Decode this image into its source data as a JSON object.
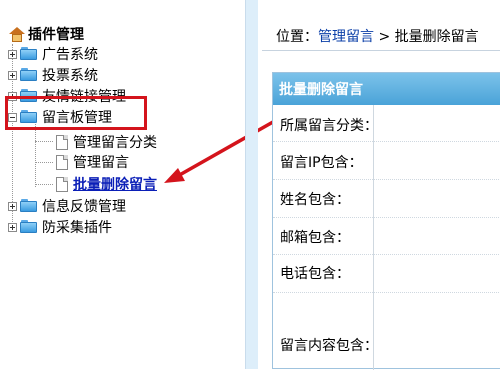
{
  "tree": {
    "root_label": "插件管理",
    "items": [
      {
        "label": "广告系统"
      },
      {
        "label": "投票系统"
      },
      {
        "label": "友情链接管理"
      },
      {
        "label": "留言板管理"
      },
      {
        "label": "管理留言分类"
      },
      {
        "label": "管理留言"
      },
      {
        "label": "批量删除留言"
      },
      {
        "label": "信息反馈管理"
      },
      {
        "label": "防采集插件"
      }
    ]
  },
  "breadcrumb": {
    "prefix": "位置：",
    "link": "管理留言",
    "separator": " > ",
    "current": "批量删除留言"
  },
  "form": {
    "title": "批量删除留言",
    "fields": [
      {
        "label": "所属留言分类："
      },
      {
        "label": "留言IP包含："
      },
      {
        "label": "姓名包含："
      },
      {
        "label": "邮箱包含："
      },
      {
        "label": "电话包含："
      },
      {
        "label": "留言内容包含："
      }
    ]
  },
  "colors": {
    "annotation_red": "#d4141c",
    "active_link": "#0b1fb7",
    "header_blue": "#4aa3d8"
  },
  "icons": [
    "home-icon",
    "folder-icon",
    "document-icon",
    "expand-plus-icon",
    "collapse-minus-icon"
  ]
}
